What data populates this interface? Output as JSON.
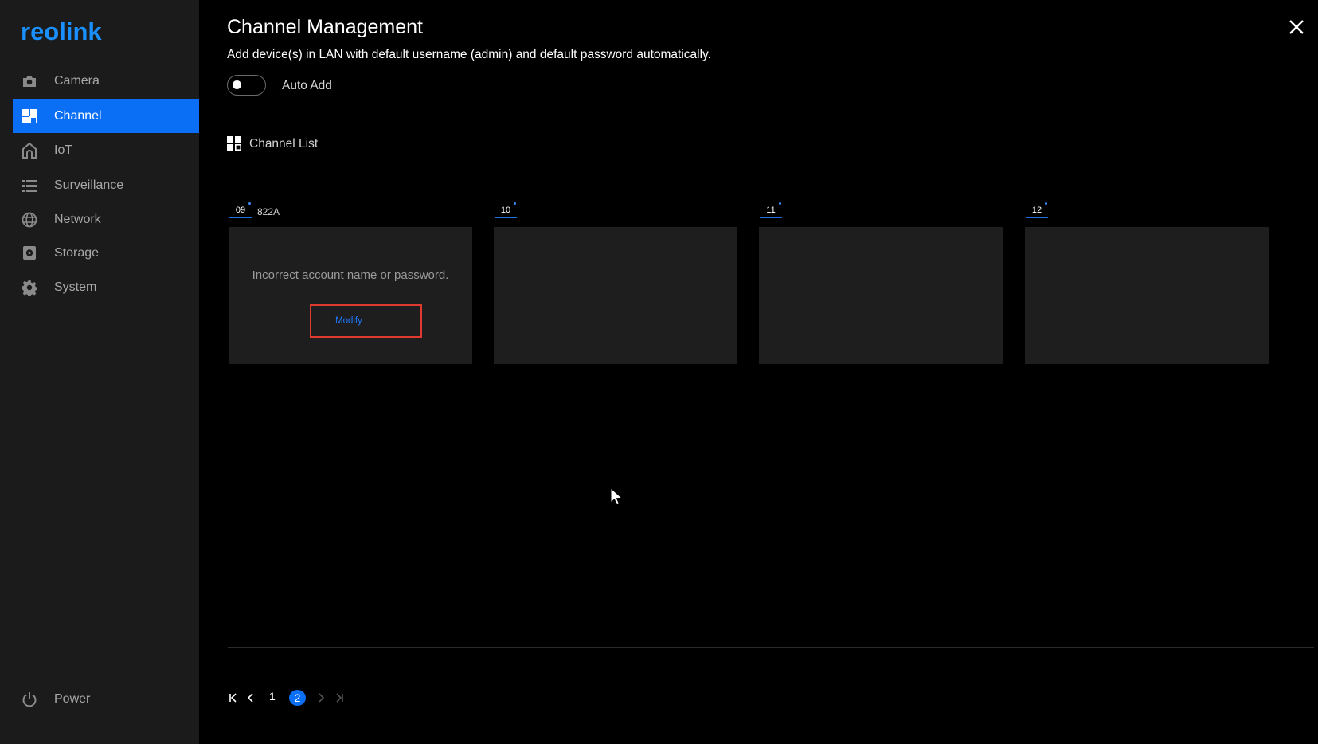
{
  "brand": {
    "logo_text": "reolink",
    "color": "#1a90ff"
  },
  "sidebar": {
    "items": [
      {
        "label": "Camera",
        "icon": "camera-icon"
      },
      {
        "label": "Channel",
        "icon": "grid-icon",
        "active": true
      },
      {
        "label": "IoT",
        "icon": "home-icon"
      },
      {
        "label": "Surveillance",
        "icon": "list-icon"
      },
      {
        "label": "Network",
        "icon": "globe-icon"
      },
      {
        "label": "Storage",
        "icon": "storage-icon"
      },
      {
        "label": "System",
        "icon": "gear-icon"
      }
    ],
    "power": {
      "label": "Power",
      "icon": "power-icon"
    }
  },
  "header": {
    "title": "Channel Management",
    "subtitle": "Add device(s) in LAN with default username (admin) and default password automatically.",
    "auto_add_label": "Auto Add",
    "auto_add_on": false
  },
  "channel_list": {
    "title": "Channel List",
    "channels": [
      {
        "number": "09",
        "name": "822A",
        "error": "Incorrect account name or password.",
        "action": "Modify"
      },
      {
        "number": "10",
        "name": ""
      },
      {
        "number": "11",
        "name": ""
      },
      {
        "number": "12",
        "name": ""
      }
    ]
  },
  "pagination": {
    "pages": [
      "1",
      "2"
    ],
    "current": "2"
  },
  "colors": {
    "accent": "#0a6ff5",
    "sidebar_bg": "#1b1b1b",
    "tile_bg": "#1e1e1e",
    "highlight": "#e03a30"
  }
}
